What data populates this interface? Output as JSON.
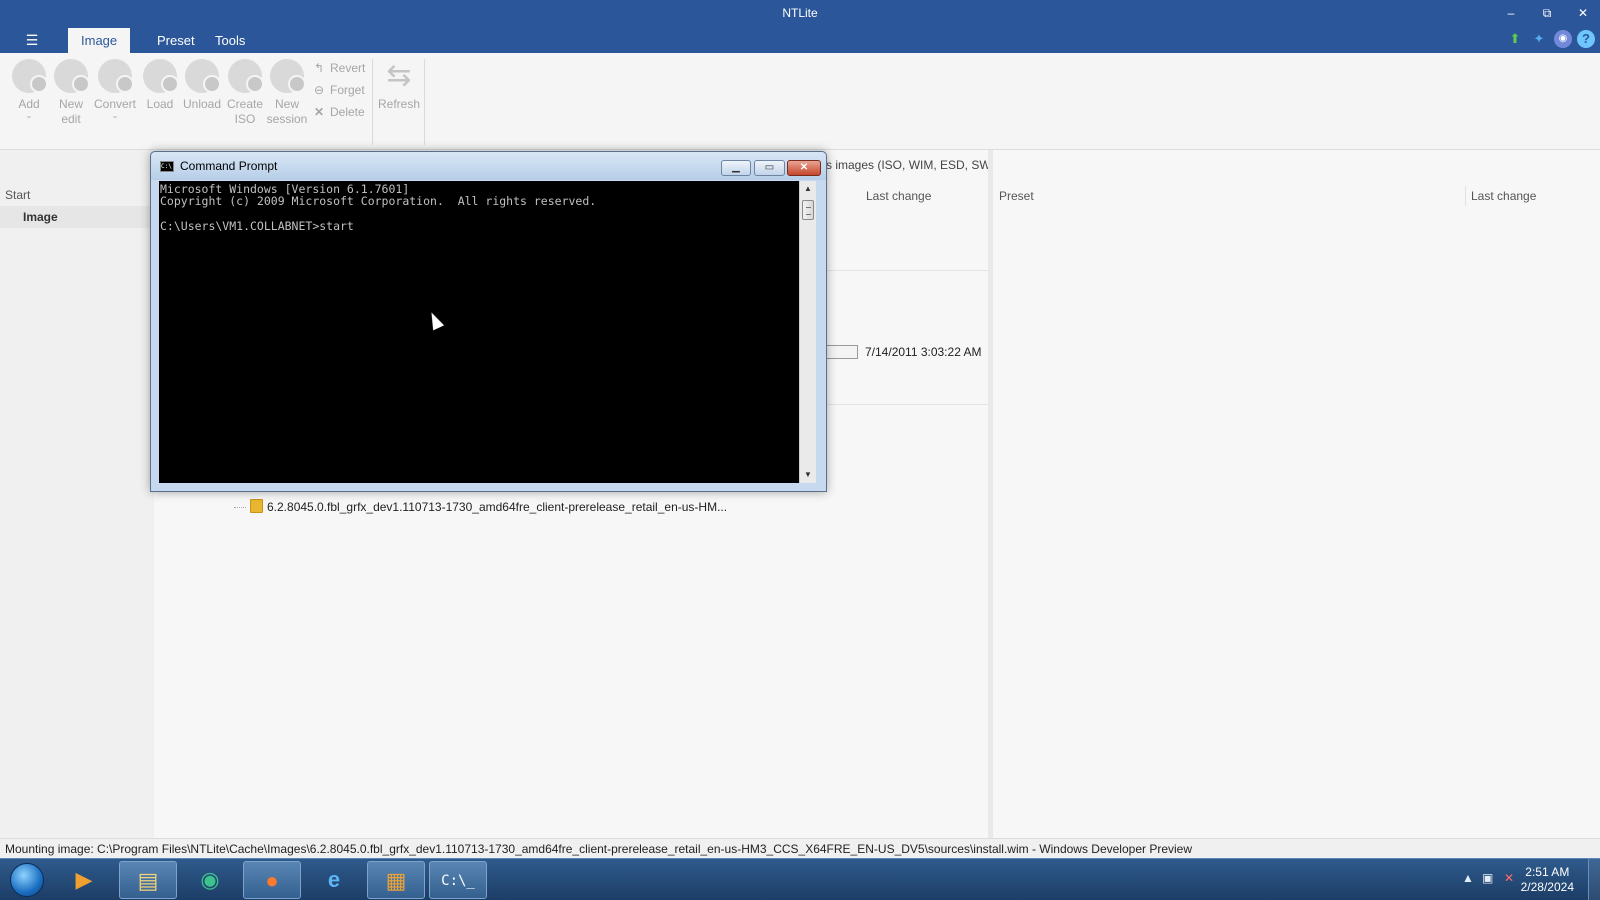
{
  "window": {
    "title": "NTLite",
    "controls": [
      "–",
      "⧉",
      "✕"
    ]
  },
  "tabs": [
    {
      "label": "Image",
      "active": true
    },
    {
      "label": "Preset",
      "active": false
    },
    {
      "label": "Tools",
      "active": false
    }
  ],
  "header_icons": [
    "update-arrow-icon",
    "twitter-icon",
    "discord-icon",
    "help-icon"
  ],
  "ribbon": {
    "add": "Add",
    "new_edit_1": "New",
    "new_edit_2": "edit",
    "convert": "Convert",
    "load": "Load",
    "unload": "Unload",
    "create_iso_1": "Create",
    "create_iso_2": "ISO",
    "new_session_1": "New",
    "new_session_2": "session",
    "revert": "Revert",
    "forget": "Forget",
    "delete": "Delete",
    "refresh": "Refresh"
  },
  "leftnav": {
    "start": "Start",
    "image": "Image"
  },
  "main": {
    "hint": "s images (ISO, WIM, ESD, SWM) or a deployment (e.g. C:\\Windows).",
    "col_last_change": "Last change",
    "date": "7/14/2011 3:03:22 AM",
    "tree_item": "6.2.8045.0.fbl_grfx_dev1.110713-1730_amd64fre_client-prerelease_retail_en-us-HM..."
  },
  "preset_pane": {
    "col_preset": "Preset",
    "col_last_change": "Last change"
  },
  "status": {
    "text": "Mounting image: C:\\Program Files\\NTLite\\Cache\\Images\\6.2.8045.0.fbl_grfx_dev1.110713-1730_amd64fre_client-prerelease_retail_en-us-HM3_CCS_X64FRE_EN-US_DV5\\sources\\install.wim - Windows Developer Preview"
  },
  "cmd": {
    "title": "Command Prompt",
    "console_text": "Microsoft Windows [Version 6.1.7601]\nCopyright (c) 2009 Microsoft Corporation.  All rights reserved.\n\nC:\\Users\\VM1.COLLABNET>start"
  },
  "taskbar": {
    "items": [
      "media-player-icon",
      "explorer-icon",
      "app-icon",
      "firefox-icon",
      "internet-explorer-icon",
      "ntlite-icon",
      "command-prompt-icon"
    ],
    "time": "2:51 AM",
    "date": "2/28/2024"
  },
  "colors": {
    "accent": "#2b579a",
    "taskbar": "#1c3d66",
    "console_bg": "#000000"
  }
}
